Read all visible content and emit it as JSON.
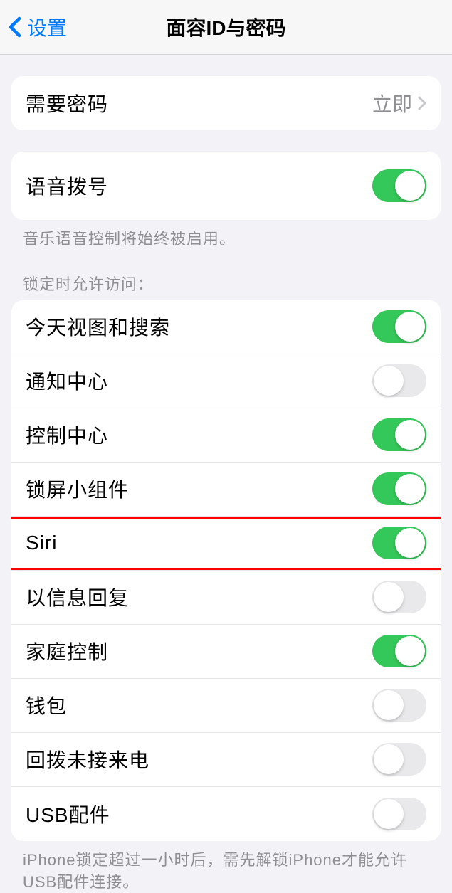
{
  "nav": {
    "back": "设置",
    "title": "面容ID与密码"
  },
  "require_passcode": {
    "label": "需要密码",
    "value": "立即"
  },
  "voice_dial": {
    "label": "语音拨号",
    "enabled": true,
    "footer": "音乐语音控制将始终被启用。"
  },
  "lock_access": {
    "header": "锁定时允许访问：",
    "items": [
      {
        "label": "今天视图和搜索",
        "enabled": true
      },
      {
        "label": "通知中心",
        "enabled": false
      },
      {
        "label": "控制中心",
        "enabled": true
      },
      {
        "label": "锁屏小组件",
        "enabled": true
      },
      {
        "label": "Siri",
        "enabled": true
      },
      {
        "label": "以信息回复",
        "enabled": false
      },
      {
        "label": "家庭控制",
        "enabled": true
      },
      {
        "label": "钱包",
        "enabled": false
      },
      {
        "label": "回拨未接来电",
        "enabled": false
      },
      {
        "label": "USB配件",
        "enabled": false
      }
    ],
    "footer": "iPhone锁定超过一小时后，需先解锁iPhone才能允许USB配件连接。"
  }
}
